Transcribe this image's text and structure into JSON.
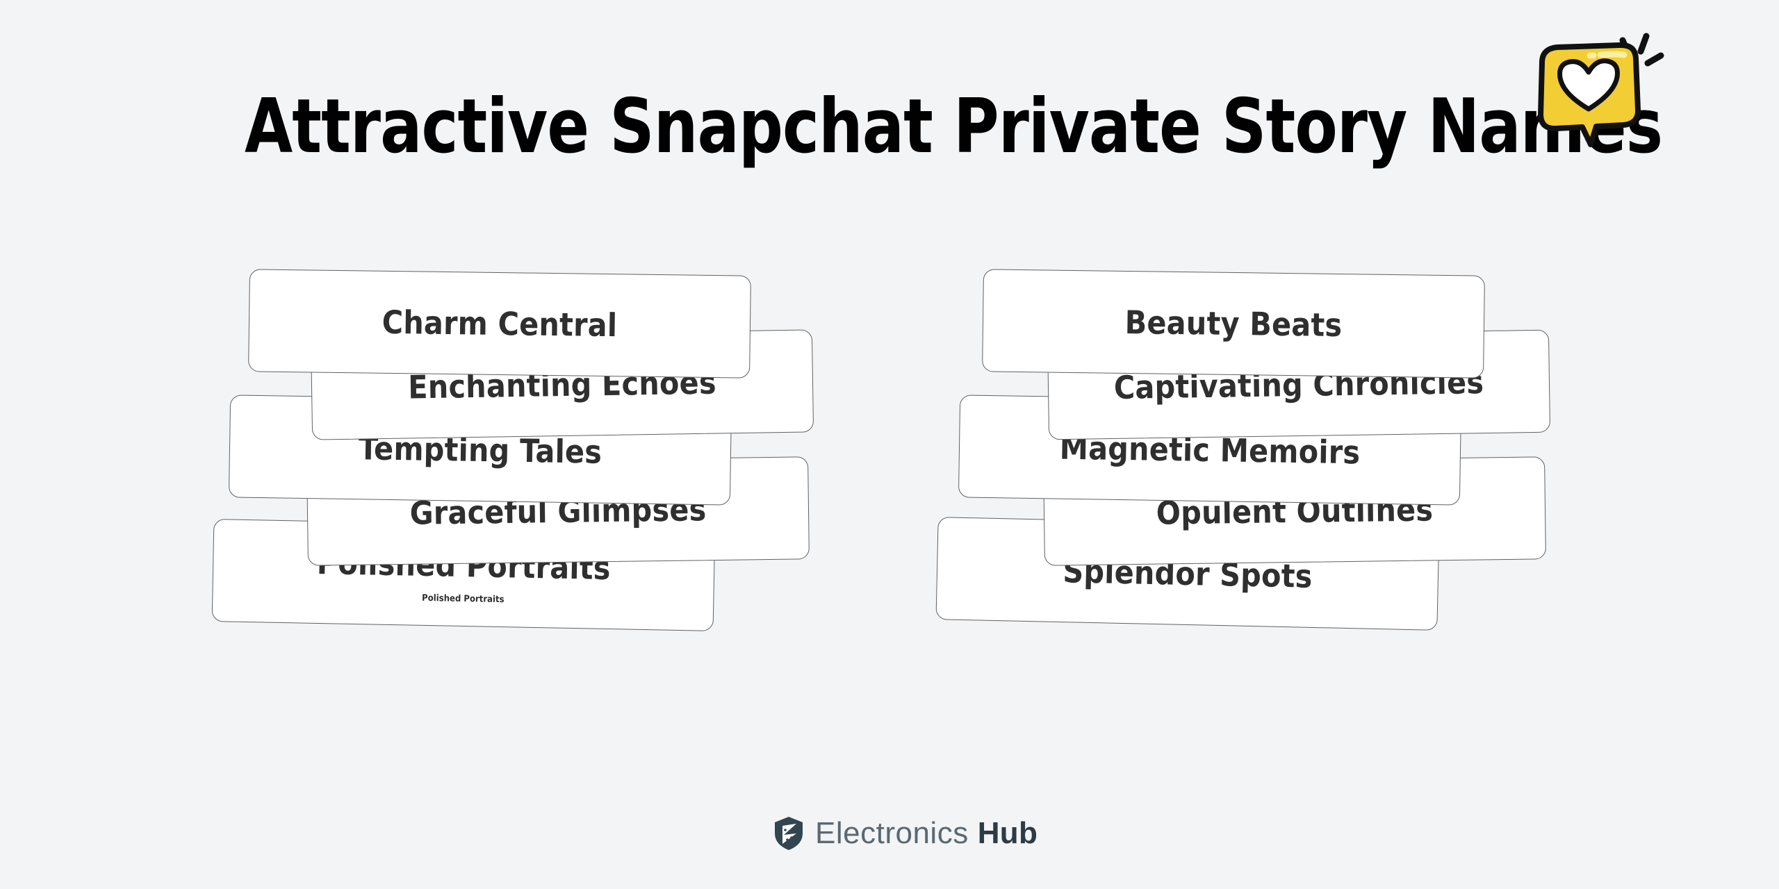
{
  "background_color": "#f3f4f6",
  "header": {
    "title": "Attractive Snapchat Private Story Names",
    "title_color": "#010101"
  },
  "sticker": {
    "icon": "heart-speech-bubble-icon",
    "bubble_color": "#f2cd33",
    "heart_color": "#ffffff",
    "outline_color": "#111111",
    "motion_lines": 3
  },
  "columns": {
    "left": {
      "cards": [
        {
          "label": "Charm Central",
          "sublabel": ""
        },
        {
          "label": "Enchanting Echoes",
          "sublabel": ""
        },
        {
          "label": "Tempting Tales",
          "sublabel": ""
        },
        {
          "label": "Graceful Glimpses",
          "sublabel": ""
        },
        {
          "label": "Polished Portraits",
          "sublabel": "Polished Portraits"
        }
      ]
    },
    "right": {
      "cards": [
        {
          "label": "Beauty Beats",
          "sublabel": ""
        },
        {
          "label": "Captivating Chronicles",
          "sublabel": ""
        },
        {
          "label": "Magnetic Memoirs",
          "sublabel": ""
        },
        {
          "label": "Opulent Outlines",
          "sublabel": ""
        },
        {
          "label": "Splendor Spots",
          "sublabel": ""
        }
      ]
    }
  },
  "card_style": {
    "background": "#ffffff",
    "border_color": "#5f6163",
    "text_color": "#2f2f2f"
  },
  "footer": {
    "logo_icon": "shield-circuit-icon",
    "brand_light": "Electronics",
    "brand_bold": "Hub",
    "brand_light_color": "#5b6871",
    "brand_bold_color": "#2e3b45"
  }
}
